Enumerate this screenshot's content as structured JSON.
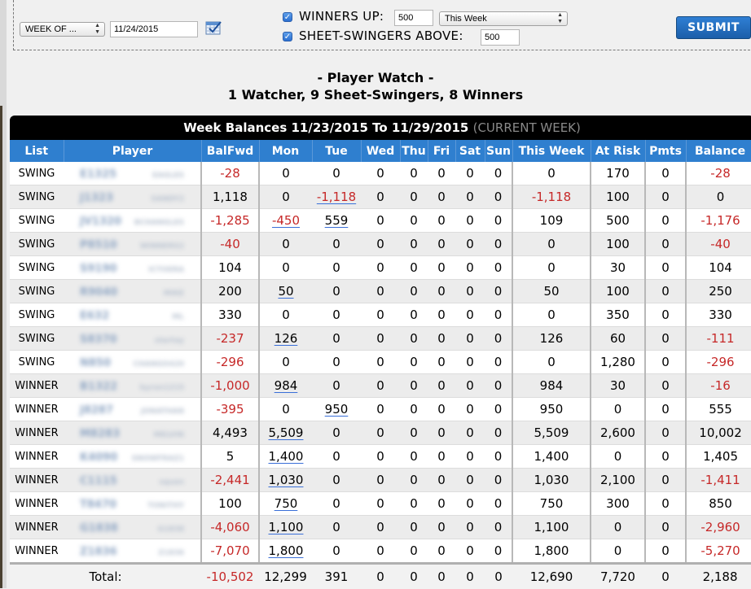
{
  "filter": {
    "period_select": "WEEK OF ...",
    "date_value": "11/24/2015",
    "winners_up_label": "WINNERS UP:",
    "winners_up_value": "500",
    "winners_range_select": "This Week",
    "swingers_label": "SHEET-SWINGERS ABOVE:",
    "swingers_value": "500",
    "submit_label": "SUBMIT"
  },
  "heading": {
    "title": "- Player Watch -",
    "subtitle": "1 Watcher, 9 Sheet-Swingers, 8 Winners"
  },
  "table": {
    "title": "Week Balances 11/23/2015 To 11/29/2015",
    "current_tag": "(CURRENT WEEK)",
    "columns": [
      "List",
      "Player",
      "BalFwd",
      "Mon",
      "Tue",
      "Wed",
      "Thu",
      "Fri",
      "Sat",
      "Sun",
      "This Week",
      "At Risk",
      "Pmts",
      "Balance"
    ],
    "rows": [
      {
        "list": "SWING",
        "id": "E1325",
        "name": "EAGLES",
        "balfwd": "-28",
        "mon": "0",
        "tue": "0",
        "wed": "0",
        "thu": "0",
        "fri": "0",
        "sat": "0",
        "sun": "0",
        "week": "0",
        "risk": "170",
        "pmts": "0",
        "balance": "-28"
      },
      {
        "list": "SWING",
        "id": "J1323",
        "name": "SANDY2",
        "balfwd": "1,118",
        "mon": "0",
        "tue": "-1,118",
        "wed": "0",
        "thu": "0",
        "fri": "0",
        "sat": "0",
        "sun": "0",
        "week": "-1,118",
        "risk": "100",
        "pmts": "0",
        "balance": "0"
      },
      {
        "list": "SWING",
        "id": "JV1320",
        "name": "BCHANGLES",
        "balfwd": "-1,285",
        "mon": "-450",
        "tue": "559",
        "wed": "0",
        "thu": "0",
        "fri": "0",
        "sat": "0",
        "sun": "0",
        "week": "109",
        "risk": "500",
        "pmts": "0",
        "balance": "-1,176"
      },
      {
        "list": "SWING",
        "id": "P8510",
        "name": "WINNERS2",
        "balfwd": "-40",
        "mon": "0",
        "tue": "0",
        "wed": "0",
        "thu": "0",
        "fri": "0",
        "sat": "0",
        "sun": "0",
        "week": "0",
        "risk": "100",
        "pmts": "0",
        "balance": "-40"
      },
      {
        "list": "SWING",
        "id": "S9190",
        "name": "ICTOERA",
        "balfwd": "104",
        "mon": "0",
        "tue": "0",
        "wed": "0",
        "thu": "0",
        "fri": "0",
        "sat": "0",
        "sun": "0",
        "week": "0",
        "risk": "30",
        "pmts": "0",
        "balance": "104"
      },
      {
        "list": "SWING",
        "id": "R9040",
        "name": "MIKE",
        "balfwd": "200",
        "mon": "50",
        "tue": "0",
        "wed": "0",
        "thu": "0",
        "fri": "0",
        "sat": "0",
        "sun": "0",
        "week": "50",
        "risk": "100",
        "pmts": "0",
        "balance": "250"
      },
      {
        "list": "SWING",
        "id": "E632",
        "name": "ML",
        "balfwd": "330",
        "mon": "0",
        "tue": "0",
        "wed": "0",
        "thu": "0",
        "fri": "0",
        "sat": "0",
        "sun": "0",
        "week": "0",
        "risk": "350",
        "pmts": "0",
        "balance": "330"
      },
      {
        "list": "SWING",
        "id": "S8370",
        "name": "startay",
        "balfwd": "-237",
        "mon": "126",
        "tue": "0",
        "wed": "0",
        "thu": "0",
        "fri": "0",
        "sat": "0",
        "sun": "0",
        "week": "126",
        "risk": "60",
        "pmts": "0",
        "balance": "-111"
      },
      {
        "list": "SWING",
        "id": "N850",
        "name": "CHANGO420",
        "balfwd": "-296",
        "mon": "0",
        "tue": "0",
        "wed": "0",
        "thu": "0",
        "fri": "0",
        "sat": "0",
        "sun": "0",
        "week": "0",
        "risk": "1,280",
        "pmts": "0",
        "balance": "-296"
      },
      {
        "list": "WINNER",
        "id": "B1322",
        "name": "byron1215",
        "balfwd": "-1,000",
        "mon": "984",
        "tue": "0",
        "wed": "0",
        "thu": "0",
        "fri": "0",
        "sat": "0",
        "sun": "0",
        "week": "984",
        "risk": "30",
        "pmts": "0",
        "balance": "-16"
      },
      {
        "list": "WINNER",
        "id": "J8287",
        "name": "JONATHAN",
        "balfwd": "-395",
        "mon": "0",
        "tue": "950",
        "wed": "0",
        "thu": "0",
        "fri": "0",
        "sat": "0",
        "sun": "0",
        "week": "950",
        "risk": "0",
        "pmts": "0",
        "balance": "555"
      },
      {
        "list": "WINNER",
        "id": "M8283",
        "name": "MELVIN",
        "balfwd": "4,493",
        "mon": "5,509",
        "tue": "0",
        "wed": "0",
        "thu": "0",
        "fri": "0",
        "sat": "0",
        "sun": "0",
        "week": "5,509",
        "risk": "2,600",
        "pmts": "0",
        "balance": "10,002"
      },
      {
        "list": "WINNER",
        "id": "K4090",
        "name": "SNOWFRAZ1",
        "balfwd": "5",
        "mon": "1,400",
        "tue": "0",
        "wed": "0",
        "thu": "0",
        "fri": "0",
        "sat": "0",
        "sun": "0",
        "week": "1,400",
        "risk": "0",
        "pmts": "0",
        "balance": "1,405"
      },
      {
        "list": "WINNER",
        "id": "C1115",
        "name": "squan",
        "balfwd": "-2,441",
        "mon": "1,030",
        "tue": "0",
        "wed": "0",
        "thu": "0",
        "fri": "0",
        "sat": "0",
        "sun": "0",
        "week": "1,030",
        "risk": "2,100",
        "pmts": "0",
        "balance": "-1,411"
      },
      {
        "list": "WINNER",
        "id": "T8470",
        "name": "TONITHY",
        "balfwd": "100",
        "mon": "750",
        "tue": "0",
        "wed": "0",
        "thu": "0",
        "fri": "0",
        "sat": "0",
        "sun": "0",
        "week": "750",
        "risk": "300",
        "pmts": "0",
        "balance": "850"
      },
      {
        "list": "WINNER",
        "id": "G1838",
        "name": "G1838",
        "balfwd": "-4,060",
        "mon": "1,100",
        "tue": "0",
        "wed": "0",
        "thu": "0",
        "fri": "0",
        "sat": "0",
        "sun": "0",
        "week": "1,100",
        "risk": "0",
        "pmts": "0",
        "balance": "-2,960"
      },
      {
        "list": "WINNER",
        "id": "Z1836",
        "name": "Z1836",
        "balfwd": "-7,070",
        "mon": "1,800",
        "tue": "0",
        "wed": "0",
        "thu": "0",
        "fri": "0",
        "sat": "0",
        "sun": "0",
        "week": "1,800",
        "risk": "0",
        "pmts": "0",
        "balance": "-5,270"
      }
    ],
    "totals": {
      "label": "Total:",
      "balfwd": "-10,502",
      "mon": "12,299",
      "tue": "391",
      "wed": "0",
      "thu": "0",
      "fri": "0",
      "sat": "0",
      "sun": "0",
      "week": "12,690",
      "risk": "7,720",
      "pmts": "0",
      "balance": "2,188"
    }
  },
  "colors": {
    "header_blue": "#2f7fcf",
    "negative_red": "#c62828",
    "submit_blue": "#1b5ea9"
  }
}
